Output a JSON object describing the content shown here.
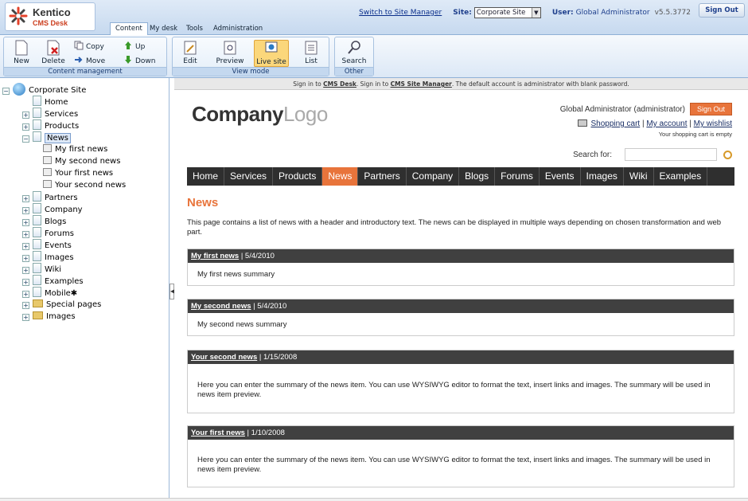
{
  "app": {
    "logo_line1": "Kentico",
    "logo_line2": "CMS Desk"
  },
  "main_tabs": [
    {
      "label": "Content"
    },
    {
      "label": "My desk"
    },
    {
      "label": "Tools"
    },
    {
      "label": "Administration"
    }
  ],
  "topbar": {
    "switch_link": "Switch to Site Manager",
    "site_label": "Site:",
    "site_value": "Corporate Site",
    "user_label": "User:",
    "user_value": "Global Administrator",
    "version": "v5.5.3772",
    "sign_out": "Sign Out"
  },
  "ribbon": {
    "content_management": {
      "label": "Content management",
      "new": "New",
      "delete": "Delete",
      "copy": "Copy",
      "move": "Move",
      "up": "Up",
      "down": "Down"
    },
    "view_mode": {
      "label": "View mode",
      "edit": "Edit",
      "preview": "Preview",
      "live_site": "Live site",
      "list": "List"
    },
    "other": {
      "label": "Other",
      "search": "Search"
    }
  },
  "tree": {
    "root": "Corporate Site",
    "items": [
      {
        "label": "Home"
      },
      {
        "label": "Services"
      },
      {
        "label": "Products"
      },
      {
        "label": "News"
      },
      {
        "label": "My first news"
      },
      {
        "label": "My second news"
      },
      {
        "label": "Your first news"
      },
      {
        "label": "Your second news"
      },
      {
        "label": "Partners"
      },
      {
        "label": "Company"
      },
      {
        "label": "Blogs"
      },
      {
        "label": "Forums"
      },
      {
        "label": "Events"
      },
      {
        "label": "Images"
      },
      {
        "label": "Wiki"
      },
      {
        "label": "Examples"
      },
      {
        "label": "Mobile✱"
      },
      {
        "label": "Special pages"
      },
      {
        "label": "Images"
      }
    ]
  },
  "site": {
    "notice_pre": "Sign in to ",
    "notice_link1": "CMS Desk",
    ". Sign in to ": "",
    "notice_mid": ". Sign in to ",
    "notice_link2": "CMS Site Manager",
    "notice_post": ". The default account is administrator with blank password.",
    "logo_a": "Company",
    "logo_b": "Logo",
    "user": "Global Administrator (administrator)",
    "sign_out": "Sign Out",
    "shopping_cart": "Shopping cart",
    "my_account": "My account",
    "my_wishlist": "My wishlist",
    "cart_empty": "Your shopping cart is empty",
    "search_label": "Search for:",
    "nav": [
      {
        "label": "Home"
      },
      {
        "label": "Services"
      },
      {
        "label": "Products"
      },
      {
        "label": "News"
      },
      {
        "label": "Partners"
      },
      {
        "label": "Company"
      },
      {
        "label": "Blogs"
      },
      {
        "label": "Forums"
      },
      {
        "label": "Events"
      },
      {
        "label": "Images"
      },
      {
        "label": "Wiki"
      },
      {
        "label": "Examples"
      }
    ],
    "title": "News",
    "intro": "This page contains a list of news with a header and introductory text. The news can be displayed in multiple ways depending on chosen transformation and web part.",
    "news": [
      {
        "title": "My first news",
        "date": " | 5/4/2010",
        "summary": "My first news summary"
      },
      {
        "title": "My second news",
        "date": " | 5/4/2010",
        "summary": "My second news summary"
      },
      {
        "title": "Your second news",
        "date": " | 1/15/2008",
        "summary": "Here you can enter the summary of the news item. You can use WYSIWYG editor to format the text, insert links and images. The summary will be used in news item preview."
      },
      {
        "title": "Your first news",
        "date": " | 1/10/2008",
        "summary": "Here you can enter the summary of the news item. You can use WYSIWYG editor to format the text, insert links and images. The summary will be used in news item preview."
      }
    ]
  }
}
